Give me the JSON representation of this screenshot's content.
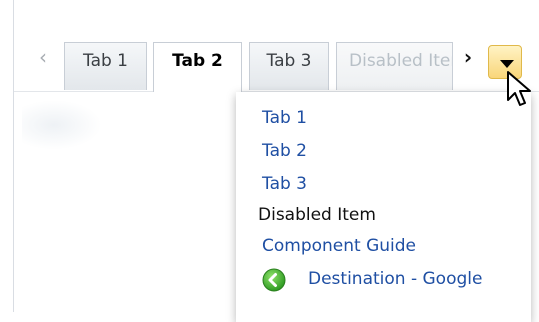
{
  "tabs": [
    {
      "label": "Tab 1",
      "state": "normal"
    },
    {
      "label": "Tab 2",
      "state": "selected"
    },
    {
      "label": "Tab 3",
      "state": "normal"
    },
    {
      "label": "Disabled Item",
      "state": "disabled"
    }
  ],
  "menu": {
    "items": [
      {
        "label": "Tab 1",
        "style": "link"
      },
      {
        "label": "Tab 2",
        "style": "link"
      },
      {
        "label": "Tab 3",
        "style": "link"
      },
      {
        "label": "Disabled Item",
        "style": "plain"
      },
      {
        "label": "Component Guide",
        "style": "link"
      },
      {
        "label": "Destination - Google",
        "style": "link",
        "icon": "green-back-arrow-icon"
      }
    ]
  },
  "colors": {
    "link": "#1f4fa3",
    "overflow_button": "#f9d67a",
    "disabled_text": "#b8c0c7"
  }
}
